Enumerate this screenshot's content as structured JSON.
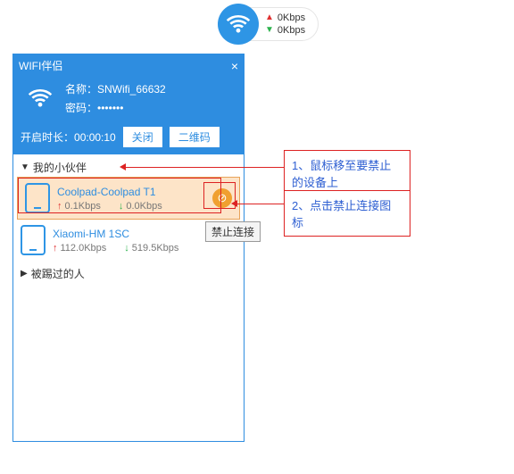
{
  "top_pill": {
    "up": "0Kbps",
    "down": "0Kbps"
  },
  "panel": {
    "title": "WIFI伴侣",
    "name_label": "名称：",
    "name_value": "SNWifi_66632",
    "pwd_label": "密码：",
    "pwd_value": "•••••••",
    "timer_label": "开启时长：",
    "timer_value": "00:00:10",
    "btn_close": "关闭",
    "btn_qr": "二维码"
  },
  "sections": {
    "partners": "我的小伙伴",
    "kicked": "被踢过的人"
  },
  "devices": [
    {
      "name": "Coolpad-Coolpad T1",
      "up": "0.1Kbps",
      "down": "0.0Kbps"
    },
    {
      "name": "Xiaomi-HM 1SC",
      "up": "112.0Kbps",
      "down": "519.5Kbps"
    }
  ],
  "tooltip": "禁止连接",
  "callouts": {
    "c1": "1、鼠标移至要禁止的设备上",
    "c2": "2、点击禁止连接图标"
  }
}
